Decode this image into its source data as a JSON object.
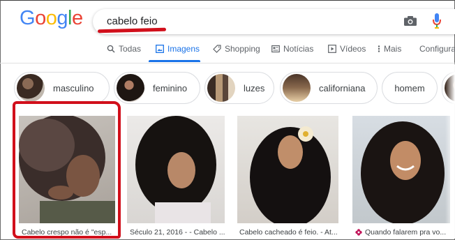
{
  "logo": {
    "letters": [
      "G",
      "o",
      "o",
      "g",
      "l",
      "e"
    ],
    "colors": [
      "#4285f4",
      "#ea4335",
      "#fbbc05",
      "#4285f4",
      "#34a853",
      "#ea4335"
    ]
  },
  "search": {
    "query": "cabelo feio"
  },
  "tabs": [
    {
      "label": "Todas",
      "icon": "search-icon"
    },
    {
      "label": "Imagens",
      "icon": "image-icon",
      "active": true
    },
    {
      "label": "Shopping",
      "icon": "tag-icon"
    },
    {
      "label": "Notícias",
      "icon": "newspaper-icon"
    },
    {
      "label": "Vídeos",
      "icon": "play-icon"
    },
    {
      "label": "Mais",
      "icon": "more-vert-icon"
    },
    {
      "label": "Configuraç",
      "icon": ""
    }
  ],
  "chips": [
    {
      "label": "masculino"
    },
    {
      "label": "feminino"
    },
    {
      "label": "luzes"
    },
    {
      "label": "californiana"
    },
    {
      "label": "homem"
    }
  ],
  "results": [
    {
      "caption": "Cabelo crespo não é \"esp..."
    },
    {
      "caption": "Século 21, 2016 - - Cabelo ..."
    },
    {
      "caption": "Cabelo cacheado é feio. - At..."
    },
    {
      "caption": "Quando falarem pra vo..."
    }
  ],
  "colors": {
    "accent": "#1a73e8",
    "annotation_red": "#d10f1b"
  }
}
